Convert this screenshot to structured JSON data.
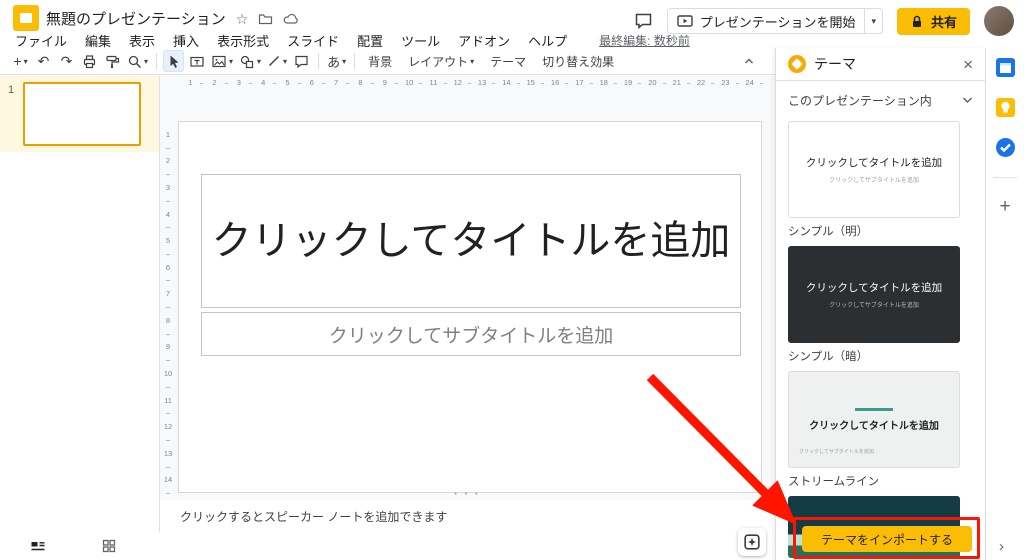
{
  "header": {
    "title": "無題のプレゼンテーション",
    "menus": [
      "ファイル",
      "編集",
      "表示",
      "挿入",
      "表示形式",
      "スライド",
      "配置",
      "ツール",
      "アドオン",
      "ヘルプ"
    ],
    "last_edit": "最終編集: 数秒前",
    "present_button": "プレゼンテーションを開始",
    "share_button": "共有"
  },
  "toolbar": {
    "text_tool": "あ",
    "background": "背景",
    "layout": "レイアウト",
    "theme": "テーマ",
    "transition": "切り替え効果"
  },
  "filmstrip": {
    "slide_number": "1"
  },
  "slide": {
    "title_placeholder": "クリックしてタイトルを追加",
    "subtitle_placeholder": "クリックしてサブタイトルを追加"
  },
  "notes": {
    "placeholder": "クリックするとスピーカー ノートを追加できます"
  },
  "theme_panel": {
    "title": "テーマ",
    "section_label": "このプレゼンテーション内",
    "import_button": "テーマをインポートする",
    "themes": [
      {
        "name": "シンプル（明）",
        "title": "クリックしてタイトルを追加",
        "subtitle": "クリックしてサブタイトルを追加"
      },
      {
        "name": "シンプル（暗）",
        "title": "クリックしてタイトルを追加",
        "subtitle": "クリックしてサブタイトルを追加"
      },
      {
        "name": "ストリームライン",
        "title": "クリックしてタイトルを追加",
        "subtitle": "クリックしてサブタイトルを追加"
      }
    ]
  },
  "rulers": {
    "horizontal": [
      1,
      2,
      3,
      4,
      5,
      6,
      7,
      8,
      9,
      10,
      11,
      12,
      13,
      14,
      15,
      16,
      17,
      18,
      19,
      20,
      21,
      22,
      23,
      24
    ],
    "vertical": [
      1,
      2,
      3,
      4,
      5,
      6,
      7,
      8,
      9,
      10,
      11,
      12,
      13,
      14
    ]
  },
  "colors": {
    "brand_yellow": "#FBBC04",
    "annotation_red": "#FF1400",
    "selected_slide_border": "#ED9D00",
    "panel_icon_orange": "#F9AB00"
  }
}
